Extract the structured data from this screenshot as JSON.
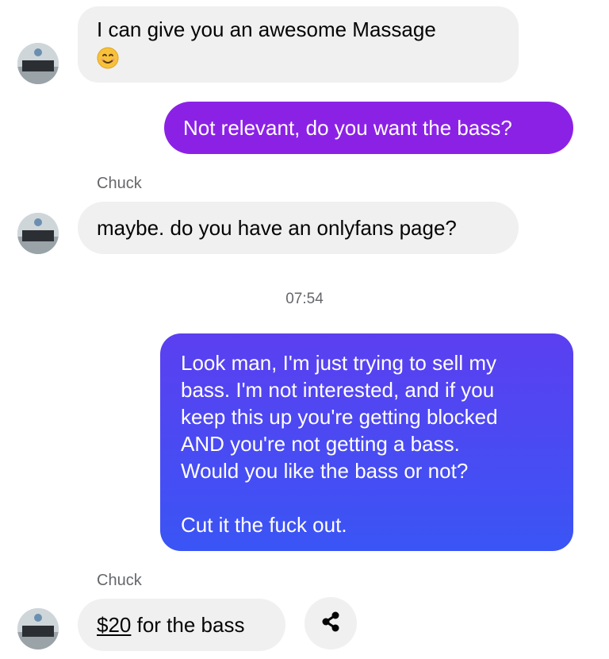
{
  "messages": {
    "m1": {
      "line1": "I can give you an awesome  Massage",
      "emoji": "smiling-face-with-smiling-eyes-icon"
    },
    "m2": {
      "text": "Not relevant, do you want the bass?"
    },
    "sender_1": "Chuck",
    "m3": {
      "text": "maybe. do you have an onlyfans page?"
    },
    "timestamp": "07:54",
    "m4": {
      "lines": [
        "Look man, I'm just trying to sell my",
        "bass. I'm not interested, and if you",
        "keep this up you're getting blocked",
        "AND you're not getting a bass.",
        "Would you like the bass or not?",
        "",
        "Cut it the fuck out."
      ]
    },
    "sender_2": "Chuck",
    "m5": {
      "price": "$20",
      "rest": " for the bass"
    }
  },
  "icons": {
    "share": "share-icon",
    "avatar": "contact-avatar"
  },
  "colors": {
    "incoming_bg": "#f0f0f0",
    "outgoing_gradient_top": "#8b23e6",
    "outgoing_gradient_bottom": "#3a55f5",
    "meta_text": "#65676b"
  }
}
